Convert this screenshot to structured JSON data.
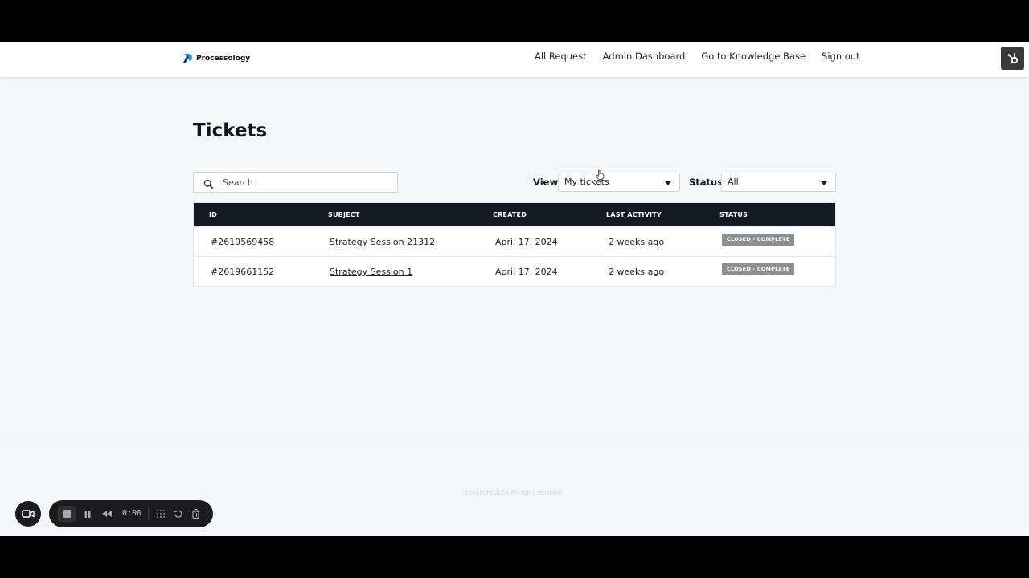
{
  "brand": {
    "name": "Processology"
  },
  "nav": {
    "links": [
      "All Request",
      "Admin Dashboard",
      "Go to Knowledge Base",
      "Sign out"
    ],
    "hubspot_icon": "hubspot-sprocket-icon"
  },
  "page": {
    "title": "Tickets"
  },
  "search": {
    "placeholder": "Search",
    "icon": "search-icon"
  },
  "filters": {
    "view": {
      "label": "View",
      "value": "My tickets"
    },
    "status": {
      "label": "Status",
      "value": "All"
    }
  },
  "table": {
    "columns": [
      "ID",
      "SUBJECT",
      "CREATED",
      "LAST ACTIVITY",
      "STATUS"
    ],
    "rows": [
      {
        "id": "#2619569458",
        "subject": "Strategy Session 21312",
        "created": "April 17, 2024",
        "last_activity": "2 weeks ago",
        "status": "CLOSED - COMPLETE"
      },
      {
        "id": "#2619661152",
        "subject": "Strategy Session 1",
        "created": "April 17, 2024",
        "last_activity": "2 weeks ago",
        "status": "CLOSED - COMPLETE"
      }
    ]
  },
  "footer": {
    "copyright": "Copyright 2024 All rights reserved."
  },
  "recorder": {
    "timer": "0:00",
    "icons": [
      "camera-icon",
      "stop-icon",
      "pause-icon",
      "rewind-icon",
      "grid-icon",
      "restart-icon",
      "trash-icon"
    ]
  },
  "colors": {
    "table_header": "#141922",
    "badge": "#8d8f93",
    "page_bg": "#f5f6f8"
  }
}
